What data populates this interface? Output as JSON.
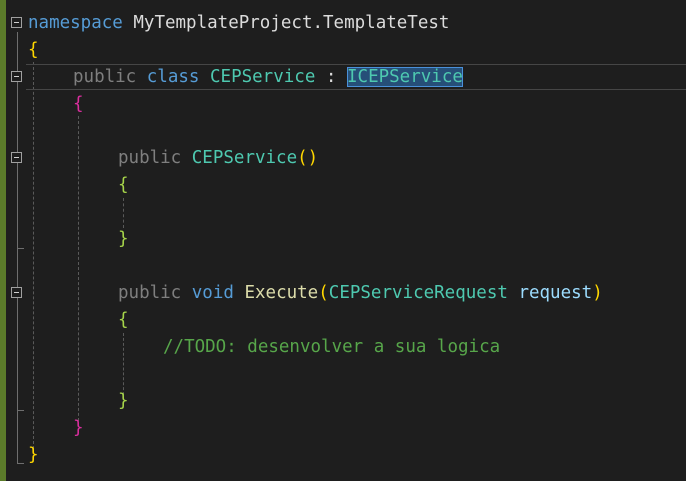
{
  "code": {
    "ns_keyword": "namespace",
    "ns_name": "MyTemplateProject.TemplateTest",
    "ns_open": "{",
    "ns_close": "}",
    "class_public": "public",
    "class_keyword": "class",
    "class_name": "CEPService",
    "class_colon": ":",
    "class_interface": "ICEPService",
    "class_open": "{",
    "class_close": "}",
    "ctor_public": "public",
    "ctor_name": "CEPService",
    "ctor_parens": "()",
    "ctor_open": "{",
    "ctor_close": "}",
    "exec_public": "public",
    "exec_void": "void",
    "exec_name": "Execute",
    "exec_paren_open": "(",
    "exec_param_type": "CEPServiceRequest",
    "exec_param_name": "request",
    "exec_paren_close": ")",
    "exec_open": "{",
    "exec_comment": "//TODO: desenvolver a sua logica",
    "exec_close": "}"
  },
  "colors": {
    "keyword": "#569cd6",
    "type": "#4ec9b0",
    "method": "#dcdcaa",
    "parameter": "#9cdcfe",
    "comment": "#57a64a",
    "brace_namespace": "#ffd700",
    "brace_class": "#da2e9e",
    "brace_method": "#a6d44a",
    "selection": "#264f78"
  },
  "icons": {
    "fold": "collapse-minus-icon"
  }
}
